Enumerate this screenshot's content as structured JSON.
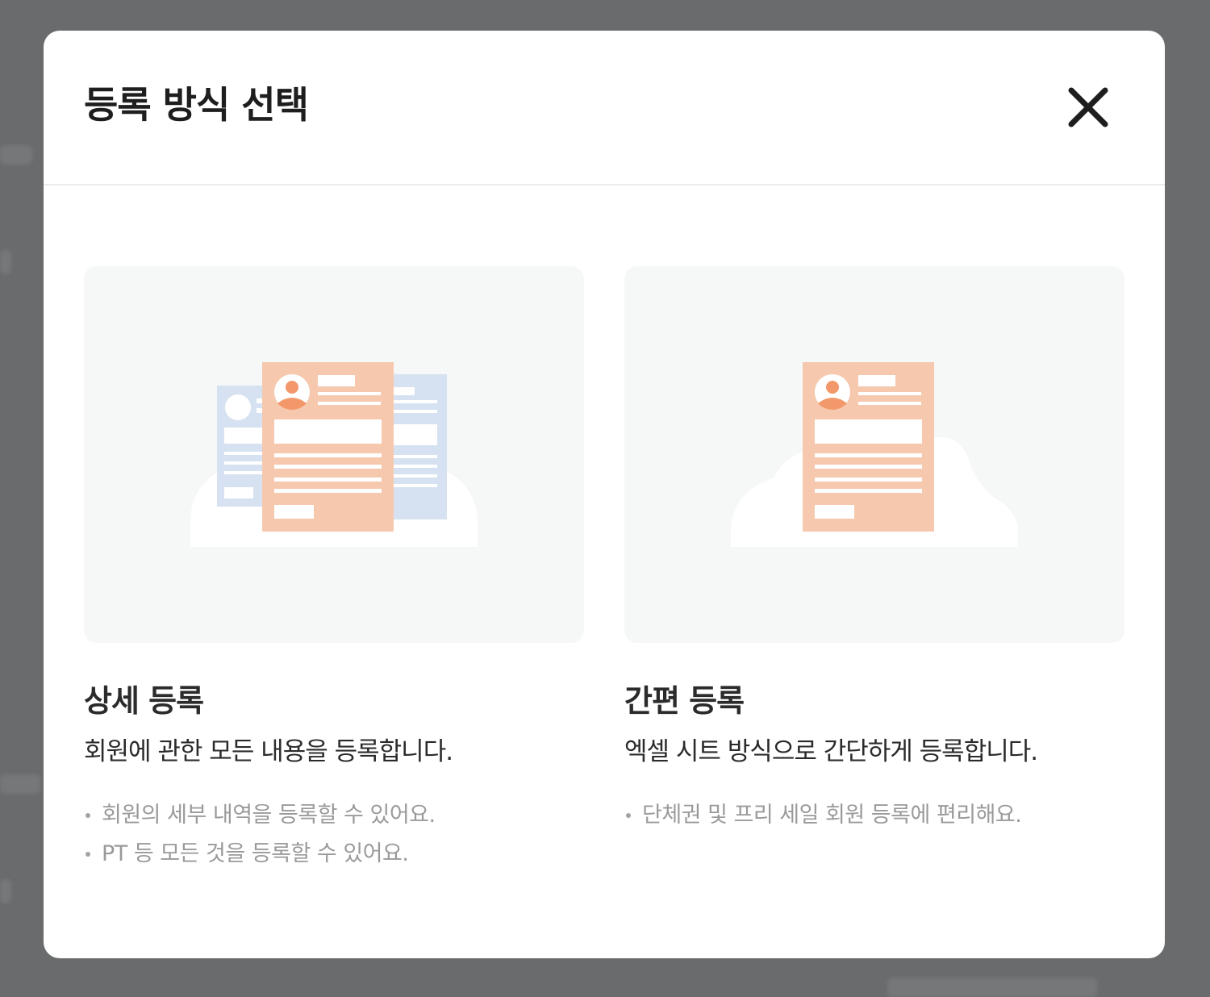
{
  "modal": {
    "title": "등록 방식 선택",
    "close_icon": "close-icon"
  },
  "options": [
    {
      "title": "상세 등록",
      "description": "회원에 관한 모든 내용을 등록합니다.",
      "bullets": [
        "회원의 세부 내역을 등록할 수 있어요.",
        "PT 등 모든 것을 등록할 수 있어요."
      ],
      "illustration": "multiple-profile-documents-icon"
    },
    {
      "title": "간편 등록",
      "description": "엑셀 시트 방식으로 간단하게 등록합니다.",
      "bullets": [
        "단체권 및 프리 세일 회원 등록에 편리해요."
      ],
      "illustration": "single-profile-document-icon"
    }
  ],
  "colors": {
    "overlay": "#6a6b6d",
    "card_background": "#f6f7f7",
    "document_orange": "#f6c8ae",
    "avatar_orange": "#f2986a",
    "document_blue": "#d6e2f1",
    "title_text": "#1e1e1e",
    "muted_text": "#9a9a9a"
  }
}
